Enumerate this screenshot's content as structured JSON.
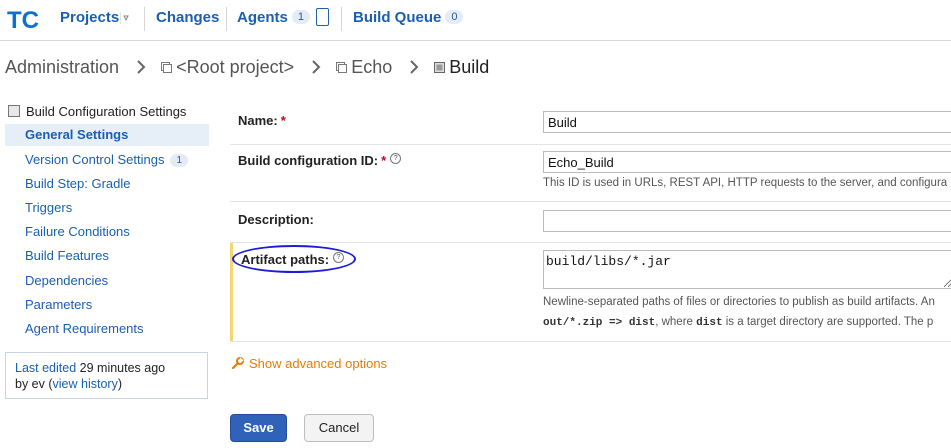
{
  "topnav": {
    "logo_text": "TC",
    "items": [
      {
        "label": "Projects"
      },
      {
        "label": "Changes"
      },
      {
        "label": "Agents",
        "badge": "1"
      },
      {
        "label": "Build Queue",
        "badge": "0"
      }
    ]
  },
  "breadcrumb": {
    "items": [
      "Administration",
      "<Root project>",
      "Echo",
      "Build"
    ]
  },
  "sidebar": {
    "title": "Build Configuration Settings",
    "items": [
      {
        "label": "General Settings",
        "active": true
      },
      {
        "label": "Version Control Settings",
        "badge": "1"
      },
      {
        "label": "Build Step: Gradle"
      },
      {
        "label": "Triggers"
      },
      {
        "label": "Failure Conditions"
      },
      {
        "label": "Build Features"
      },
      {
        "label": "Dependencies"
      },
      {
        "label": "Parameters"
      },
      {
        "label": "Agent Requirements"
      }
    ],
    "last_edited": {
      "prefix": "Last edited",
      "time": "29 minutes ago",
      "by_prefix": "by ev",
      "view_history": "view history"
    }
  },
  "form": {
    "name": {
      "label": "Name:",
      "value": "Build"
    },
    "build_config_id": {
      "label": "Build configuration ID:",
      "value": "Echo_Build",
      "note": "This ID is used in URLs, REST API, HTTP requests to the server, and configura"
    },
    "description": {
      "label": "Description:",
      "value": ""
    },
    "artifact_paths": {
      "label": "Artifact paths:",
      "value": "build/libs/*.jar",
      "note_line1": "Newline-separated paths of files or directories to publish as build artifacts. An",
      "note_line2_code1": "out/*.zip => dist",
      "note_line2_mid": ", where ",
      "note_line2_code2": "dist",
      "note_line2_end": " is a target directory are supported. The p"
    },
    "required_mark": "*",
    "help_mark": "?",
    "show_advanced": "Show advanced options",
    "save_label": "Save",
    "cancel_label": "Cancel"
  },
  "colors": {
    "link": "#1a5fb4",
    "required": "#d0021b",
    "advanced": "#e67e00",
    "save_bg": "#2f62b8",
    "highlight_ellipse": "#1c1cd8",
    "artifact_bar": "#f4d675"
  }
}
